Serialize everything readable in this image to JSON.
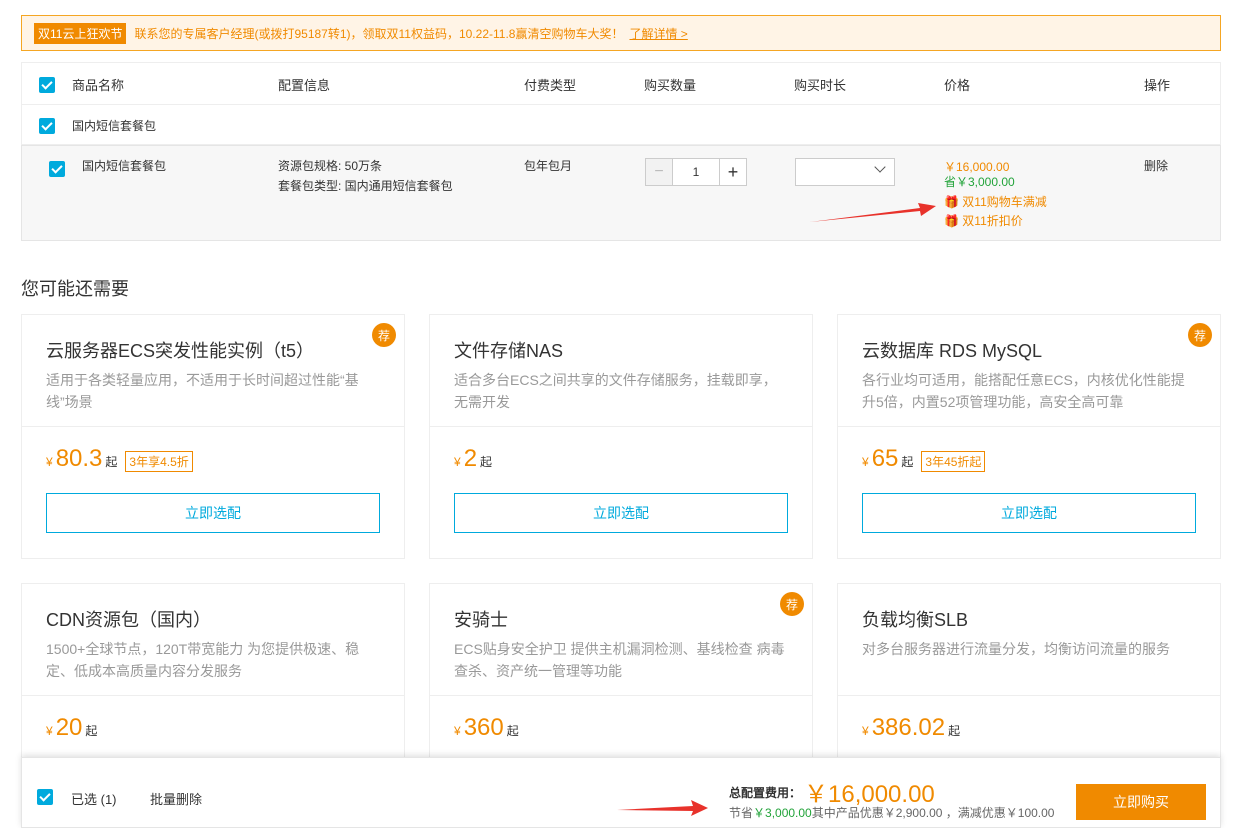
{
  "banner": {
    "tag": "双11云上狂欢节",
    "text": "联系您的专属客户经理(或拨打95187转1)，领取双11权益码，10.22-11.8赢清空购物车大奖！",
    "link": "了解详情 >"
  },
  "table": {
    "headers": [
      "商品名称",
      "配置信息",
      "付费类型",
      "购买数量",
      "购买时长",
      "价格",
      "操作"
    ]
  },
  "group": {
    "name": "国内短信套餐包"
  },
  "item": {
    "name": "国内短信套餐包",
    "config": [
      "资源包规格: 50万条",
      "套餐包类型: 国内通用短信套餐包"
    ],
    "pay_type": "包年包月",
    "quantity": "1",
    "duration": "",
    "price": "￥16,000.00",
    "saving": "省￥3,000.00",
    "promos": [
      "双11购物车满减",
      "双11折扣价"
    ],
    "delete": "删除"
  },
  "section_title": "您可能还需要",
  "cards": [
    {
      "title": "云服务器ECS突发性能实例（t5）",
      "desc": "适用于各类轻量应用，不适用于长时间超过性能“基线”场景",
      "yen": "¥",
      "price": "80.3",
      "qi": "起",
      "badge": "3年享4.5折",
      "rec": "荐",
      "button": "立即选配"
    },
    {
      "title": "文件存储NAS",
      "desc": "适合多台ECS之间共享的文件存储服务，挂载即享，无需开发",
      "yen": "¥",
      "price": "2",
      "qi": "起",
      "badge": "",
      "rec": "",
      "button": "立即选配"
    },
    {
      "title": "云数据库 RDS MySQL",
      "desc": "各行业均可适用，能搭配任意ECS，内核优化性能提升5倍，内置52项管理功能，高安全高可靠",
      "yen": "¥",
      "price": "65",
      "qi": "起",
      "badge": "3年45折起",
      "rec": "荐",
      "button": "立即选配"
    },
    {
      "title": "CDN资源包（国内）",
      "desc": "1500+全球节点，120T带宽能力 为您提供极速、稳定、低成本高质量内容分发服务",
      "yen": "¥",
      "price": "20",
      "qi": "起",
      "badge": "",
      "rec": "",
      "button": ""
    },
    {
      "title": "安骑士",
      "desc": "ECS贴身安全护卫 提供主机漏洞检测、基线检查 病毒查杀、资产统一管理等功能",
      "yen": "¥",
      "price": "360",
      "qi": "起",
      "badge": "",
      "rec": "荐",
      "button": ""
    },
    {
      "title": "负载均衡SLB",
      "desc": "对多台服务器进行流量分发，均衡访问流量的服务",
      "yen": "¥",
      "price": "386.02",
      "qi": "起",
      "badge": "",
      "rec": "",
      "button": ""
    }
  ],
  "footer": {
    "selected": "已选 (1)",
    "batch_delete": "批量删除",
    "total_label": "总配置费用：",
    "total": "￥16,000.00",
    "save_prefix": "节省",
    "save_amount": "￥3,000.00",
    "save_detail": "其中产品优惠￥2,900.00 ，满减优惠￥100.00",
    "buy": "立即购买"
  },
  "colors": {
    "accent": "#f08a00",
    "primary": "#00aadd",
    "green": "#22a33a"
  }
}
